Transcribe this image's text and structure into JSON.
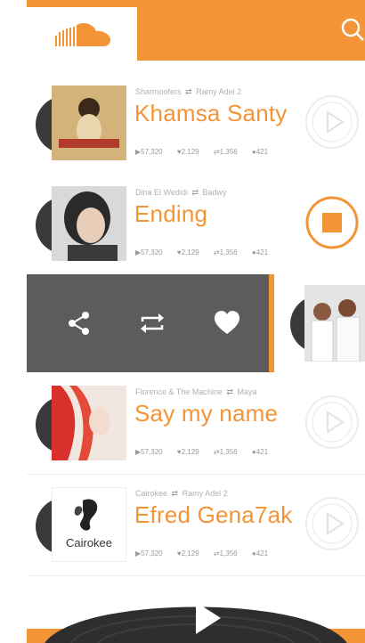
{
  "header": {
    "logo_icon": "soundcloud-cloud-icon",
    "search_icon": "search-icon",
    "accent": "#f39437"
  },
  "tracks": [
    {
      "artist": "Sharmoofers",
      "reposter": "Ramy Adel 2",
      "title": "Khamsa Santy",
      "plays": "57,320",
      "likes": "2,129",
      "reposts": "1,356",
      "comments": "421",
      "state": "paused"
    },
    {
      "artist": "Dina El Wedidi",
      "reposter": "Badwy",
      "title": "Ending",
      "plays": "57,320",
      "likes": "2,129",
      "reposts": "1,356",
      "comments": "421",
      "state": "playing"
    },
    {
      "artist": "Florence & The Machine",
      "reposter": "Maya",
      "title": "Say my name",
      "plays": "57,320",
      "likes": "2,129",
      "reposts": "1,356",
      "comments": "421",
      "state": "paused"
    },
    {
      "artist": "Cairokee",
      "reposter": "Ramy Adel 2",
      "title": "Efred Gena7ak",
      "plays": "57,320",
      "likes": "2,129",
      "reposts": "1,356",
      "comments": "421",
      "state": "paused",
      "art_text": "Cairokee"
    }
  ],
  "swipe_actions": [
    "share-icon",
    "repost-icon",
    "heart-icon"
  ],
  "player": {
    "play_icon": "play-icon"
  }
}
